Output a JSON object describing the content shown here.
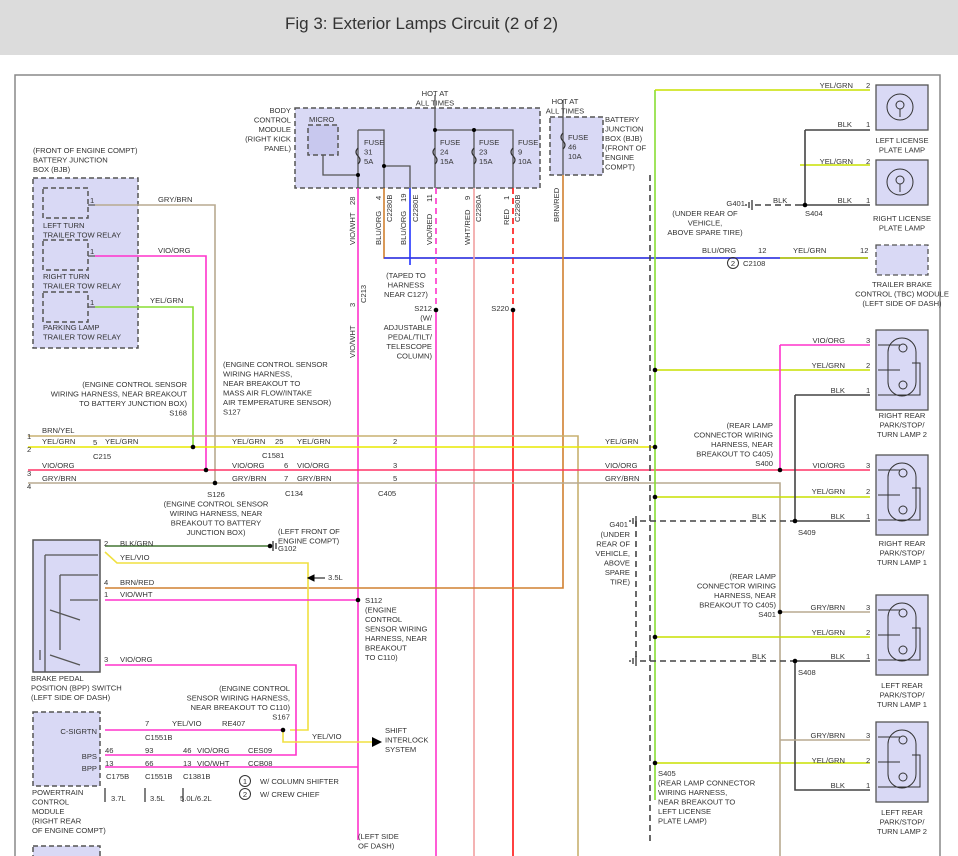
{
  "title": "Fig 3: Exterior Lamps Circuit (2 of 2)",
  "colors": {
    "VIO": "#ff33cc",
    "YEL_GRN": "#d6e600",
    "GRN": "#88dd33",
    "GRY_BRN": "#b8aa90",
    "BRN_YEL": "#c8b070",
    "VIO_ORG": "#ff3366",
    "BLU": "#2233ff",
    "BRN_RED": "#d08030",
    "RED": "#ff1111",
    "WHT_RED": "#f2a0a0",
    "BLK": "#444444",
    "YEL_VIO": "#f0e040",
    "module_fill": "#d9d9f5"
  },
  "labels": {
    "bjb_left": [
      "(FRONT OF ENGINE COMPT)",
      "BATTERY JUNCTION",
      "BOX (BJB)"
    ],
    "relay1": [
      "LEFT TURN",
      "TRAILER TOW RELAY"
    ],
    "relay2": [
      "RIGHT TURN",
      "TRAILER TOW RELAY"
    ],
    "relay3": [
      "PARKING LAMP",
      "TRAILER TOW RELAY"
    ],
    "relay1_pin": [
      "1"
    ],
    "relay2_pin": [
      "1"
    ],
    "relay3_pin": [
      "1"
    ],
    "gry_brn_top": [
      "GRY/BRN"
    ],
    "vio_org_top": [
      "VIO/ORG"
    ],
    "yel_grn_top": [
      "YEL/GRN"
    ],
    "bcm": [
      "BODY",
      "CONTROL",
      "MODULE",
      "(RIGHT KICK",
      "PANEL)"
    ],
    "micro": [
      "MICRO"
    ],
    "hot1": [
      "HOT AT",
      "ALL TIMES"
    ],
    "fuse31": [
      "FUSE",
      "31",
      "5A"
    ],
    "fuse24": [
      "FUSE",
      "24",
      "15A"
    ],
    "fuse23": [
      "FUSE",
      "23",
      "15A"
    ],
    "fuse9": [
      "FUSE",
      "9",
      "10A"
    ],
    "hot2": [
      "HOT AT",
      "ALL TIMES"
    ],
    "fuse46": [
      "FUSE",
      "46",
      "10A"
    ],
    "bjb_right": [
      "BATTERY",
      "JUNCTION",
      "BOX (BJB)",
      "(FRONT OF",
      "ENGINE",
      "COMPT)"
    ],
    "v28": [
      "28"
    ],
    "v_vio_wht": [
      "VIO/WHT"
    ],
    "v4": [
      "4"
    ],
    "v_blu_org1": [
      "BLU/ORG"
    ],
    "v_c2280b1": [
      "C2280B"
    ],
    "v19": [
      "19"
    ],
    "v_blu_org2": [
      "BLU/ORG"
    ],
    "v_c2280e": [
      "C2280E"
    ],
    "v11": [
      "11"
    ],
    "v_vio_red": [
      "VIO/RED"
    ],
    "v9": [
      "9"
    ],
    "v_wht_red": [
      "WHT/RED"
    ],
    "v_c2280a": [
      "C2280A"
    ],
    "v1": [
      "1"
    ],
    "v_red": [
      "RED"
    ],
    "v_c2280b2": [
      "C2280B"
    ],
    "v_brn_red": [
      "BRN/RED"
    ],
    "c213_pin": [
      "3"
    ],
    "c213": [
      "C213"
    ],
    "v_vio_wht2": [
      "VIO/WHT"
    ],
    "taped": [
      "(TAPED TO",
      "HARNESS",
      "NEAR C127)"
    ],
    "s212": [
      "S212",
      "(W/",
      "ADJUSTABLE",
      "PEDAL/TILT/",
      "TELESCOPE",
      "COLUMN)"
    ],
    "s220": [
      "S220"
    ],
    "ll_yg": [
      "YEL/GRN"
    ],
    "ll_p2": [
      "2"
    ],
    "ll_blk": [
      "BLK"
    ],
    "ll_p1": [
      "1"
    ],
    "left_license": [
      "LEFT LICENSE",
      "PLATE LAMP"
    ],
    "rl_yg": [
      "YEL/GRN"
    ],
    "rl_p2": [
      "2"
    ],
    "rl_blk": [
      "BLK"
    ],
    "rl_p1": [
      "1"
    ],
    "right_license": [
      "RIGHT LICENSE",
      "PLATE LAMP"
    ],
    "g401_top": [
      "G401"
    ],
    "g401_top_loc": [
      "(UNDER REAR OF",
      "VEHICLE,",
      "ABOVE SPARE TIRE)"
    ],
    "g401_blk": [
      "BLK"
    ],
    "s404": [
      "S404"
    ],
    "tbc_blu": [
      "BLU/ORG"
    ],
    "tbc_12a": [
      "12"
    ],
    "tbc_c2108": [
      "C2108"
    ],
    "tbc_circ": [
      "2"
    ],
    "tbc_yg": [
      "YEL/GRN"
    ],
    "tbc_12b": [
      "12"
    ],
    "tbc": [
      "TRAILER BRAKE",
      "CONTROL (TBC) MODULE",
      "(LEFT SIDE OF DASH)"
    ],
    "rr2_vo": [
      "VIO/ORG"
    ],
    "rr2_p3": [
      "3"
    ],
    "rr2_yg": [
      "YEL/GRN"
    ],
    "rr2_p2": [
      "2"
    ],
    "rr2_blk": [
      "BLK"
    ],
    "rr2_p1": [
      "1"
    ],
    "rr2": [
      "RIGHT REAR",
      "PARK/STOP/",
      "TURN LAMP 2"
    ],
    "s400": [
      "(REAR LAMP",
      "CONNECTOR WIRING",
      "HARNESS, NEAR",
      "BREAKOUT TO C405)",
      "S400"
    ],
    "r1_n": [
      "1"
    ],
    "r1_lbl": [
      "BRN/YEL"
    ],
    "r2_n": [
      "2"
    ],
    "r2_lbl": [
      "YEL/GRN"
    ],
    "c215_pin": [
      "5"
    ],
    "r2_lbl2": [
      "YEL/GRN"
    ],
    "c215": [
      "C215"
    ],
    "r2_lbl3": [
      "YEL/GRN"
    ],
    "c1581_pin": [
      "25"
    ],
    "r2_lbl4": [
      "YEL/GRN"
    ],
    "c1581": [
      "C1581"
    ],
    "c405_p2": [
      "2"
    ],
    "r2_lbl5": [
      "YEL/GRN"
    ],
    "r3_n": [
      "3"
    ],
    "r3_lbl": [
      "VIO/ORG"
    ],
    "r3_lbl2": [
      "VIO/ORG"
    ],
    "c134_p6": [
      "6"
    ],
    "r3_lbl3": [
      "VIO/ORG"
    ],
    "c405_p3": [
      "3"
    ],
    "r3_lbl4": [
      "VIO/ORG"
    ],
    "rr1_vo": [
      "VIO/ORG"
    ],
    "rr1_p3": [
      "3"
    ],
    "r4_n": [
      "4"
    ],
    "r4_lbl": [
      "GRY/BRN"
    ],
    "r4_lbl2": [
      "GRY/BRN"
    ],
    "c134_p7": [
      "7"
    ],
    "r4_lbl3": [
      "GRY/BRN"
    ],
    "c134": [
      "C134"
    ],
    "c405_p5": [
      "5"
    ],
    "c405": [
      "C405"
    ],
    "r4_lbl4": [
      "GRY/BRN"
    ],
    "s168": [
      "(ENGINE CONTROL SENSOR",
      "WIRING HARNESS, NEAR BREAKOUT",
      "TO BATTERY JUNCTION BOX)",
      "S168"
    ],
    "s127": [
      "(ENGINE CONTROL SENSOR",
      "WIRING HARNESS,",
      "NEAR BREAKOUT TO",
      "MASS AIR FLOW/INTAKE",
      "AIR TEMPERATURE SENSOR)",
      "S127"
    ],
    "s126": [
      "S126",
      "(ENGINE CONTROL SENSOR",
      "WIRING HARNESS, NEAR",
      "BREAKOUT TO BATTERY",
      "JUNCTION BOX)"
    ],
    "rr1_yg": [
      "YEL/GRN"
    ],
    "rr1_p2": [
      "2"
    ],
    "rr1_blk_a": [
      "BLK"
    ],
    "rr1_blk": [
      "BLK"
    ],
    "rr1_p1": [
      "1"
    ],
    "s409": [
      "S409"
    ],
    "rr1": [
      "RIGHT REAR",
      "PARK/STOP/",
      "TURN LAMP 1"
    ],
    "g401_mid": [
      "G401"
    ],
    "g401_mid_loc": [
      "(UNDER",
      "REAR OF",
      "VEHICLE,",
      "ABOVE",
      "SPARE",
      "TIRE)"
    ],
    "s401": [
      "(REAR LAMP",
      "CONNECTOR WIRING",
      "HARNESS, NEAR",
      "BREAKOUT TO C405)",
      "S401"
    ],
    "lr1_gb": [
      "GRY/BRN"
    ],
    "lr1_p3": [
      "3"
    ],
    "lr1_yg": [
      "YEL/GRN"
    ],
    "lr1_p2": [
      "2"
    ],
    "lr1_blk_a": [
      "BLK"
    ],
    "lr1_blk": [
      "BLK"
    ],
    "lr1_p1": [
      "1"
    ],
    "s408": [
      "S408"
    ],
    "lr1": [
      "LEFT REAR",
      "PARK/STOP/",
      "TURN LAMP 1"
    ],
    "lr2_gb": [
      "GRY/BRN"
    ],
    "lr2_p3": [
      "3"
    ],
    "lr2_yg": [
      "YEL/GRN"
    ],
    "lr2_p2": [
      "2"
    ],
    "lr2_blk": [
      "BLK"
    ],
    "lr2_p1": [
      "1"
    ],
    "lr2": [
      "LEFT REAR",
      "PARK/STOP/",
      "TURN LAMP 2"
    ],
    "s405": [
      "S405",
      "(REAR LAMP CONNECTOR",
      "WIRING HARNESS,",
      "NEAR BREAKOUT TO",
      "LEFT LICENSE",
      "PLATE LAMP)"
    ],
    "bpp_p2": [
      "2"
    ],
    "bpp_blk_grn": [
      "BLK/GRN"
    ],
    "bpp_yel_vio": [
      "YEL/VIO"
    ],
    "bpp_p4": [
      "4"
    ],
    "bpp_brn_red": [
      "BRN/RED"
    ],
    "bpp_p1": [
      "1"
    ],
    "bpp_vio_wht": [
      "VIO/WHT"
    ],
    "bpp_p3": [
      "3"
    ],
    "bpp_vio_org": [
      "VIO/ORG"
    ],
    "g102_loc": [
      "(LEFT FRONT OF",
      "ENGINE COMPT)"
    ],
    "g102": [
      "G102"
    ],
    "l35_a": [
      "3.5L"
    ],
    "s112": [
      "S112",
      "(ENGINE",
      "CONTROL",
      "SENSOR WIRING",
      "HARNESS, NEAR",
      "BREAKOUT",
      "TO C110)"
    ],
    "bpp": [
      "BRAKE PEDAL",
      "POSITION (BPP) SWITCH",
      "(LEFT SIDE OF DASH)"
    ],
    "s167": [
      "(ENGINE CONTROL",
      "SENSOR WIRING HARNESS,",
      "NEAR BREAKOUT TO C110)",
      "S167"
    ],
    "pcm_csig": [
      "C-SIGRTN"
    ],
    "pcm_bps": [
      "BPS"
    ],
    "pcm_bpp": [
      "BPP"
    ],
    "cs_7": [
      "7"
    ],
    "cs_yv": [
      "YEL/VIO"
    ],
    "cs_re407": [
      "RE407"
    ],
    "cs_c1551b": [
      "C1551B"
    ],
    "bps_46a": [
      "46"
    ],
    "bps_93": [
      "93"
    ],
    "bps_46b": [
      "46"
    ],
    "bps_vo": [
      "VIO/ORG"
    ],
    "bps_ces09": [
      "CES09"
    ],
    "bpp_13a": [
      "13"
    ],
    "bpp_66": [
      "66"
    ],
    "bpp_13b": [
      "13"
    ],
    "bpp_vw": [
      "VIO/WHT"
    ],
    "bpp_ccb08": [
      "CCB08"
    ],
    "c175b": [
      "C175B"
    ],
    "c1551b2": [
      "C1551B"
    ],
    "c1381b": [
      "C1381B"
    ],
    "l37": [
      "3.7L"
    ],
    "l35_b": [
      "3.5L"
    ],
    "l50": [
      "5.0L/6.2L"
    ],
    "legend1_n": [
      "1"
    ],
    "legend1": [
      "W/ COLUMN SHIFTER"
    ],
    "legend2_n": [
      "2"
    ],
    "legend2": [
      "W/ CREW CHIEF"
    ],
    "shift_yv": [
      "YEL/VIO"
    ],
    "shift": [
      "SHIFT",
      "INTERLOCK",
      "SYSTEM"
    ],
    "pcm": [
      "POWERTRAIN",
      "CONTROL",
      "MODULE",
      "(RIGHT REAR",
      "OF ENGINE COMPT)"
    ],
    "left_side": [
      "(LEFT SIDE",
      "OF DASH)"
    ]
  }
}
